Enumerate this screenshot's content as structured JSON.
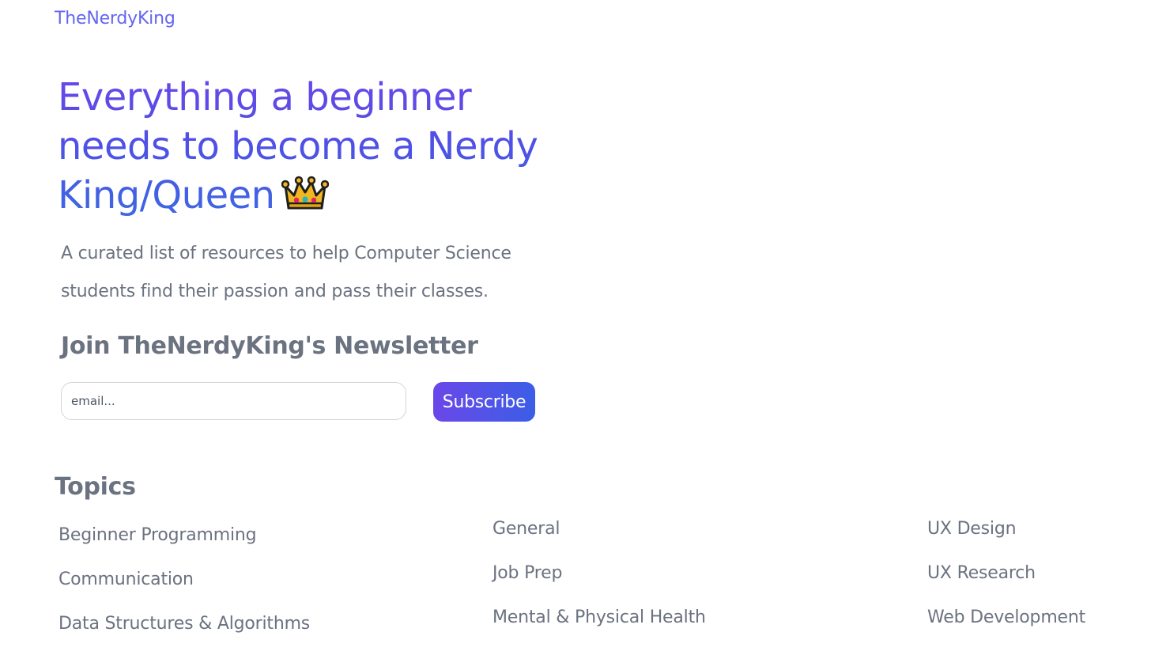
{
  "header": {
    "brand": "TheNerdyKing"
  },
  "hero": {
    "title": "Everything a beginner needs to become a Nerdy King/Queen",
    "subtitle": "A curated list of resources to help Computer Science students find their passion and pass their classes."
  },
  "newsletter": {
    "heading": "Join TheNerdyKing's Newsletter",
    "email_placeholder": "email...",
    "email_value": "",
    "subscribe_label": "Subscribe"
  },
  "topics": {
    "heading": "Topics",
    "columns": [
      [
        "Beginner Programming",
        "Communication",
        "Data Structures & Algorithms"
      ],
      [
        "General",
        "Job Prep",
        "Mental & Physical Health"
      ],
      [
        "UX Design",
        "UX Research",
        "Web Development"
      ]
    ]
  },
  "colors": {
    "brand": "#6366f1",
    "gradient_start": "#6a47e8",
    "gradient_end": "#3c6ae2",
    "muted_text": "#6b7280"
  },
  "icons": {
    "hero_emoji": "crown-icon"
  }
}
